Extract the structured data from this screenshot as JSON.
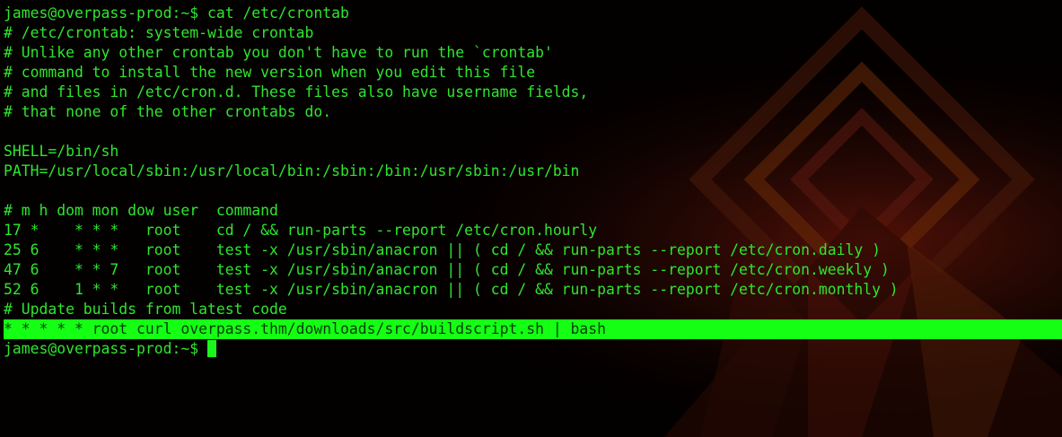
{
  "terminal": {
    "lines": [
      "james@overpass-prod:~$ cat /etc/crontab",
      "# /etc/crontab: system-wide crontab",
      "# Unlike any other crontab you don't have to run the `crontab'",
      "# command to install the new version when you edit this file",
      "# and files in /etc/cron.d. These files also have username fields,",
      "# that none of the other crontabs do.",
      "",
      "SHELL=/bin/sh",
      "PATH=/usr/local/sbin:/usr/local/bin:/sbin:/bin:/usr/sbin:/usr/bin",
      "",
      "# m h dom mon dow user  command",
      "17 *    * * *   root    cd / && run-parts --report /etc/cron.hourly",
      "25 6    * * *   root    test -x /usr/sbin/anacron || ( cd / && run-parts --report /etc/cron.daily )",
      "47 6    * * 7   root    test -x /usr/sbin/anacron || ( cd / && run-parts --report /etc/cron.weekly )",
      "52 6    1 * *   root    test -x /usr/sbin/anacron || ( cd / && run-parts --report /etc/cron.monthly )",
      "# Update builds from latest code",
      "* * * * * root curl overpass.thm/downloads/src/buildscript.sh | bash"
    ],
    "prompt": "james@overpass-prod:~$ ",
    "highlighted_line_index": 16
  },
  "colors": {
    "text": "#2ee62e",
    "highlight_bg": "#15ff15",
    "background": "#030000"
  }
}
